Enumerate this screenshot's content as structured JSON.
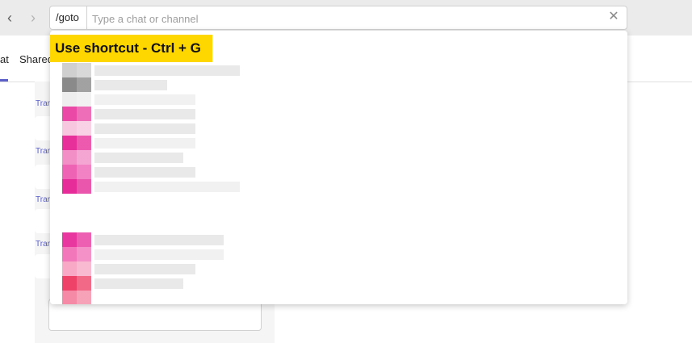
{
  "nav": {
    "back_glyph": "‹",
    "forward_glyph": "›"
  },
  "search": {
    "command": "/goto",
    "placeholder": "Type a chat or channel",
    "clear_glyph": "✕"
  },
  "tabs": {
    "items": [
      "at",
      "Shared"
    ]
  },
  "chat": {
    "translate_labels": [
      "Trar",
      "Trar",
      "Trar",
      "Trar"
    ]
  },
  "dropdown": {
    "shortcut_hint": "Use shortcut - Ctrl + G",
    "row_colors": [
      "#cfcfcf",
      "#8a8a8a",
      "#eeeeee",
      "#ea4aa6",
      "#f7c6df",
      "#e8309a",
      "#f28fc6",
      "#ee63b4",
      "#e52c98",
      "#ffffff",
      "#e8379e",
      "#f176ba",
      "#f7a9c5",
      "#ef4269",
      "#f48aa5"
    ]
  },
  "colors": {
    "accent": "#5b5fc7",
    "highlight": "#ffd700",
    "topbar": "#ebebeb"
  }
}
